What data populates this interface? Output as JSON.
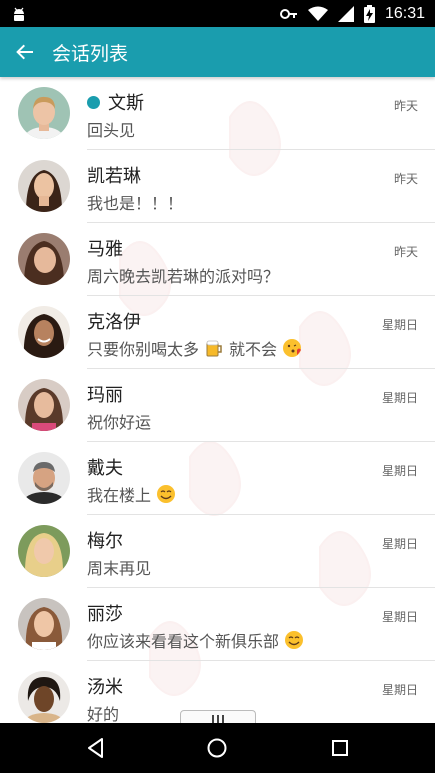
{
  "status_bar": {
    "time": "16:31"
  },
  "app_bar": {
    "title": "会话列表"
  },
  "colors": {
    "accent": "#1a9dae",
    "status_bar": "#000000",
    "nav_bar": "#000000"
  },
  "conversations": [
    {
      "name": "文斯",
      "message": "回头见",
      "time": "昨天",
      "online": true
    },
    {
      "name": "凯若琳",
      "message": "我也是！！！",
      "time": "昨天",
      "online": false
    },
    {
      "name": "马雅",
      "message": "周六晚去凯若琳的派对吗？",
      "time": "昨天",
      "online": false
    },
    {
      "name": "克洛伊",
      "message_parts": [
        "只要你别喝太多",
        "就不会"
      ],
      "time": "星期日",
      "emoji": [
        "beer-mug-emoji",
        "blowing-kiss-emoji"
      ]
    },
    {
      "name": "玛丽",
      "message": "祝你好运",
      "time": "星期日"
    },
    {
      "name": "戴夫",
      "message": "我在楼上",
      "time": "星期日",
      "emoji": [
        "smiling-face-emoji"
      ]
    },
    {
      "name": "梅尔",
      "message": "周末再见",
      "time": "星期日"
    },
    {
      "name": "丽莎",
      "message": "你应该来看看这个新俱乐部",
      "time": "星期日",
      "emoji": [
        "smiling-face-emoji"
      ]
    },
    {
      "name": "汤米",
      "message": "好的",
      "time": "星期日"
    }
  ]
}
